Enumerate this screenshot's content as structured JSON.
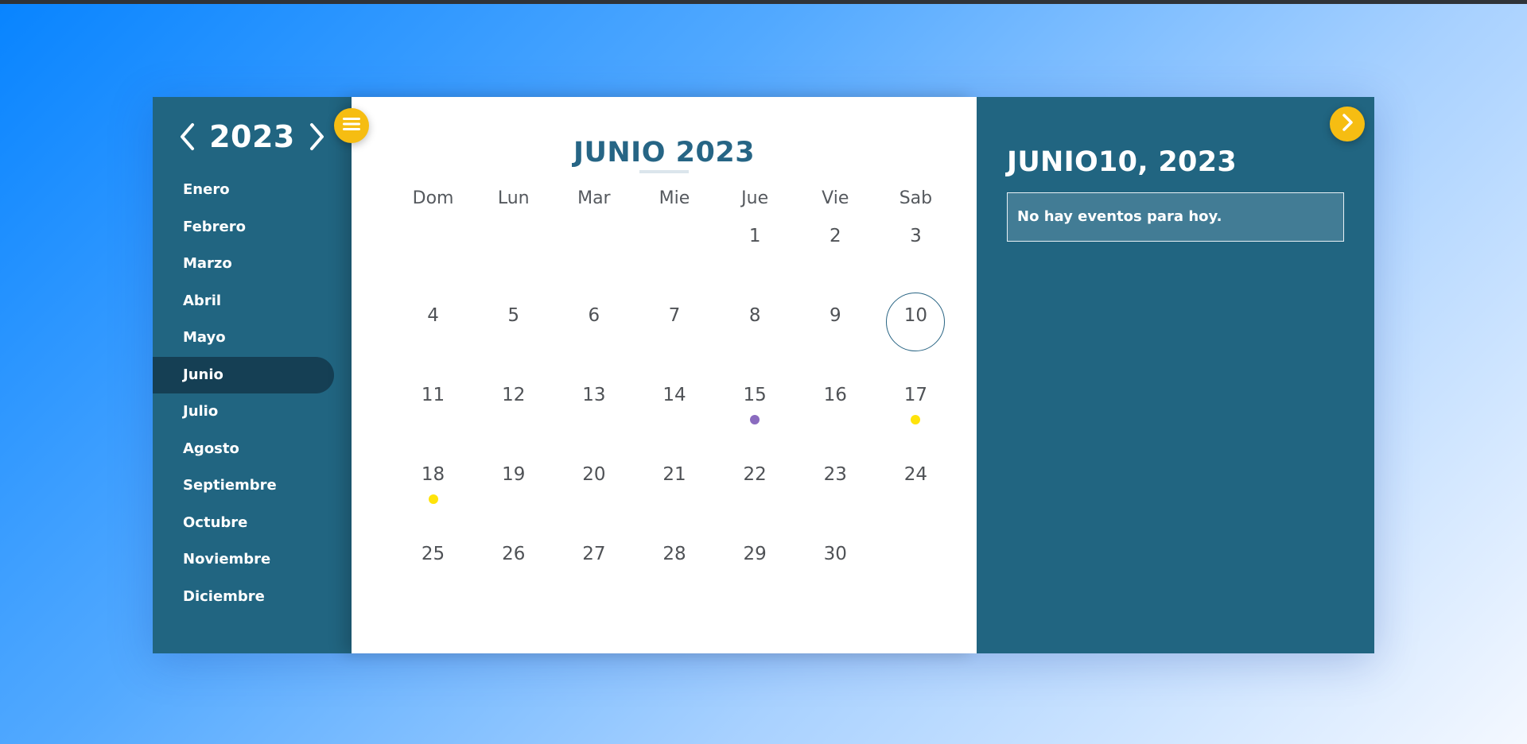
{
  "sidebar": {
    "year": "2023",
    "months": [
      "Enero",
      "Febrero",
      "Marzo",
      "Abril",
      "Mayo",
      "Junio",
      "Julio",
      "Agosto",
      "Septiembre",
      "Octubre",
      "Noviembre",
      "Diciembre"
    ],
    "active_month": "Junio"
  },
  "calendar": {
    "title": "JUNIO 2023",
    "weekdays": [
      "Dom",
      "Lun",
      "Mar",
      "Mie",
      "Jue",
      "Vie",
      "Sab"
    ],
    "first_weekday_index": 4,
    "days_in_month": 30,
    "selected_day": 10,
    "event_markers": [
      {
        "day": 15,
        "color": "#8a6bbf"
      },
      {
        "day": 17,
        "color": "#ffe30a"
      },
      {
        "day": 18,
        "color": "#ffe30a"
      }
    ]
  },
  "events_panel": {
    "date_heading": "JUNIO10, 2023",
    "empty_message": "No hay eventos para hoy."
  },
  "icons": {
    "prev_year": "chevron-left-icon",
    "next_year": "chevron-right-icon",
    "menu": "hamburger-menu-icon",
    "next": "chevron-right-icon"
  },
  "colors": {
    "panel": "#216581",
    "active_month": "#153f54",
    "accent": "#f6bd12",
    "title": "#266585"
  }
}
